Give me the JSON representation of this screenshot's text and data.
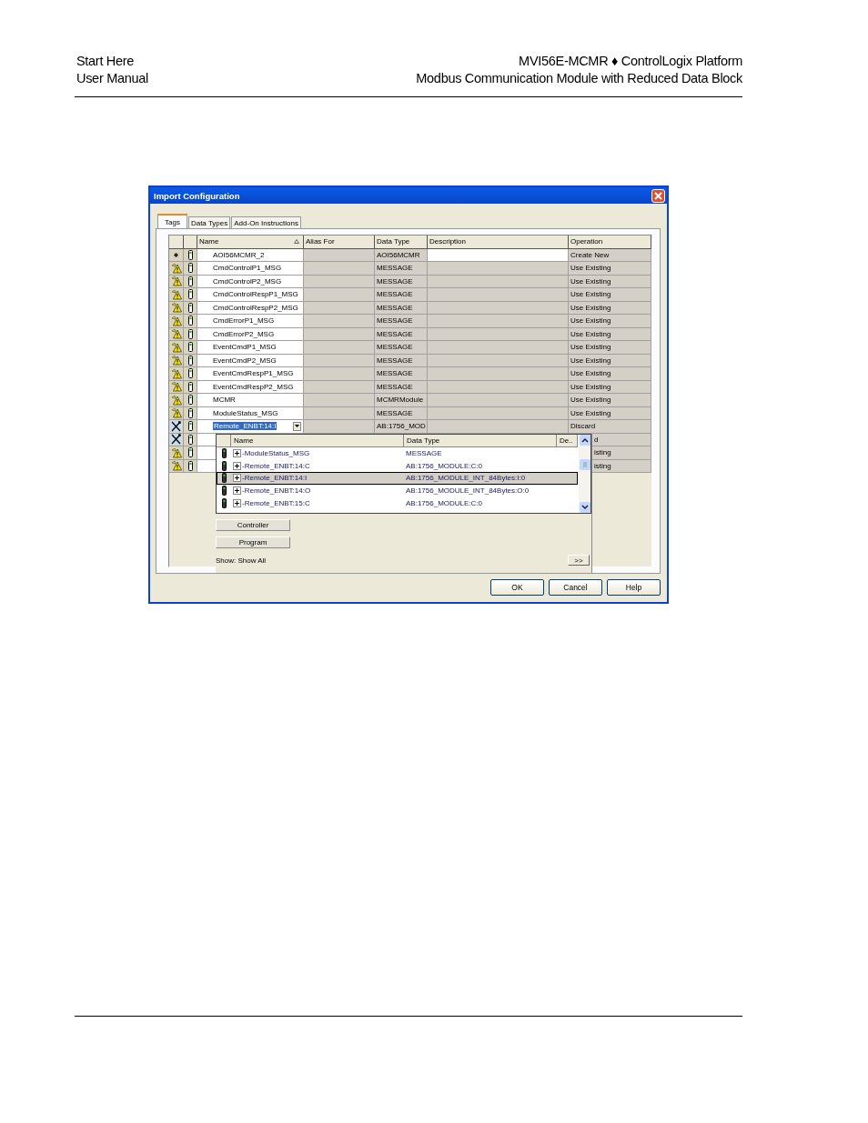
{
  "header": {
    "left": [
      "Start Here",
      "User Manual"
    ],
    "right": [
      "MVI56E-MCMR ♦ ControlLogix Platform",
      "Modbus Communication Module with Reduced Data Block"
    ]
  },
  "dialog": {
    "title": "Import Configuration",
    "tabs": [
      {
        "label": "Tags",
        "selected": true
      },
      {
        "label": "Data Types",
        "selected": false
      },
      {
        "label": "Add-On Instructions",
        "selected": false
      }
    ],
    "columns": [
      "Name",
      "Alias For",
      "Data Type",
      "Description",
      "Operation"
    ],
    "rows": [
      {
        "kind": "new",
        "name": "AOI56MCMR_2",
        "data_type": "AOI56MCMR",
        "operation": "Create New"
      },
      {
        "kind": "warning",
        "name": "CmdControlP1_MSG",
        "data_type": "MESSAGE",
        "operation": "Use Existing"
      },
      {
        "kind": "warning",
        "name": "CmdControlP2_MSG",
        "data_type": "MESSAGE",
        "operation": "Use Existing"
      },
      {
        "kind": "warning",
        "name": "CmdControlRespP1_MSG",
        "data_type": "MESSAGE",
        "operation": "Use Existing"
      },
      {
        "kind": "warning",
        "name": "CmdControlRespP2_MSG",
        "data_type": "MESSAGE",
        "operation": "Use Existing"
      },
      {
        "kind": "warning",
        "name": "CmdErrorP1_MSG",
        "data_type": "MESSAGE",
        "operation": "Use Existing"
      },
      {
        "kind": "warning",
        "name": "CmdErrorP2_MSG",
        "data_type": "MESSAGE",
        "operation": "Use Existing"
      },
      {
        "kind": "warning",
        "name": "EventCmdP1_MSG",
        "data_type": "MESSAGE",
        "operation": "Use Existing"
      },
      {
        "kind": "warning",
        "name": "EventCmdP2_MSG",
        "data_type": "MESSAGE",
        "operation": "Use Existing"
      },
      {
        "kind": "warning",
        "name": "EventCmdRespP1_MSG",
        "data_type": "MESSAGE",
        "operation": "Use Existing"
      },
      {
        "kind": "warning",
        "name": "EventCmdRespP2_MSG",
        "data_type": "MESSAGE",
        "operation": "Use Existing"
      },
      {
        "kind": "warning",
        "name": "MCMR",
        "data_type": "MCMRModule",
        "operation": "Use Existing"
      },
      {
        "kind": "warning",
        "name": "ModuleStatus_MSG",
        "data_type": "MESSAGE",
        "operation": "Use Existing"
      },
      {
        "kind": "discard",
        "name": "Remote_ENBT:14:I",
        "editing": true,
        "data_type": "AB:1756_MOD",
        "operation": "Discard"
      },
      {
        "kind": "discard",
        "operation": "d"
      },
      {
        "kind": "warning",
        "operation": "isting"
      },
      {
        "kind": "warning",
        "operation": "isting"
      }
    ],
    "picker": {
      "columns": [
        "Name",
        "Data Type",
        "De.."
      ],
      "items": [
        {
          "name": "-ModuleStatus_MSG",
          "data_type": "MESSAGE",
          "selected": false
        },
        {
          "name": "-Remote_ENBT:14:C",
          "data_type": "AB:1756_MODULE:C:0",
          "selected": false
        },
        {
          "name": "-Remote_ENBT:14:I",
          "data_type": "AB:1756_MODULE_INT_84Bytes:I:0",
          "selected": true
        },
        {
          "name": "-Remote_ENBT:14:O",
          "data_type": "AB:1756_MODULE_INT_84Bytes:O:0",
          "selected": false
        },
        {
          "name": "-Remote_ENBT:15:C",
          "data_type": "AB:1756_MODULE:C:0",
          "selected": false
        }
      ],
      "scope_buttons": [
        "Controller",
        "Program"
      ],
      "show": "Show: Show All",
      "more_button": ">>"
    },
    "buttons": [
      "OK",
      "Cancel",
      "Help"
    ]
  }
}
